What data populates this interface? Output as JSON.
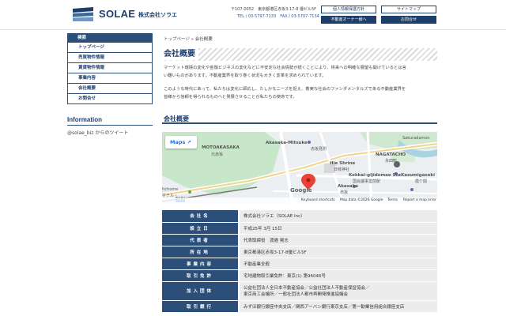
{
  "header": {
    "brand": "SOLAE",
    "brand_jp": "株式会社ソラエ",
    "address": "〒107-0052　東京都港区赤坂3-17-8 優ビル5F",
    "contact": "TEL / 03-5797-7133　FAX / 03-5797-7134",
    "buttons": {
      "privacy": "個人情報保護方針",
      "sitemap": "サイトマップ",
      "owner": "不動産オーナー様へ",
      "contact": "お問合せ"
    }
  },
  "sidebar": {
    "search": "検索",
    "items": [
      "トップページ",
      "売買物件情報",
      "賃貸物件情報",
      "事業内容",
      "会社概要",
      "お問合せ"
    ],
    "info_title": "Information",
    "tweet_text": "@solae_biz からのツイート"
  },
  "main": {
    "breadcrumb": "トップページ » 会社概要",
    "title": "会社概要",
    "para1_line1": "マーケット環境の変化や金融ビジネスの変化などに不安定な社会情勢が続くことにより、将来への明確な展望も開けているとは言",
    "para1_line2": "い難いものがあります。不動産業界を取り巻く状況も大きく変革を求められています。",
    "para2_line1": "このような時代にあって、私たちは変化に即応し、たしかなニーズを捉え、着実な社会のファンダメンタルズである不動産業界を",
    "para2_line2": "皆様から信頼を得られるものへと発展させることが私たちの使命です。",
    "section_title": "会社概要"
  },
  "map": {
    "maps_button": "Maps",
    "labels": {
      "motoakasaka": "MOTOAKASAKA",
      "motoakasaka_jp": "元赤坂",
      "akasaka_mitsuke": "Akasaka-Mitsuke",
      "akasaka_mitsuke_jp": "赤坂見附",
      "nagatacho": "NAGATACHO",
      "nagatacho_jp": "永田町",
      "sakuradamon": "Sakuradamon",
      "hie_shrine": "Hie Shrine",
      "hie_shrine_jp": "日枝神社",
      "kokkai": "Kokkai-gijidomae Sta.",
      "kokkai_jp": "国会議事堂前駅",
      "kasumigaseki": "Kasumigaseki",
      "kasumigaseki_jp": "霞ケ関",
      "akasaka": "Akasaka",
      "akasaka_jp": "赤坂",
      "hotel_left": "ltchome",
      "hotel_left2": "ホテル・",
      "route": "319"
    },
    "footer": {
      "google": "Google",
      "shortcuts": "Keyboard shortcuts",
      "mapdata": "Map data ©2026 Google",
      "terms": "Terms",
      "report": "Report a map error"
    }
  },
  "company_table": [
    {
      "key": "会社名",
      "value": "株式会社ソラエ（SOLAE Inc）"
    },
    {
      "key": "設立日",
      "value": "平成25年 3月 15日"
    },
    {
      "key": "代表者",
      "value": "代表取締役　渡邉 晃志"
    },
    {
      "key": "所在地",
      "value": "東京都港区赤坂3-17-8優ビル5F"
    },
    {
      "key": "事業内容",
      "value": "不動産業全般"
    },
    {
      "key": "取引免許",
      "value": "宅地建物取引業免許：東京(1) 第96046号"
    },
    {
      "key": "加入団体",
      "value": "公益社団法人全日本不動産協会／公益社団法人不動産保証協会／",
      "value2": "東京商工会議所／一般社団法人都市再開発推進協議会"
    },
    {
      "key": "取引銀行",
      "value": "みずほ銀行銀座中央支店／関西アーバン銀行東京支店／第一勧業信用組合銀座支店"
    }
  ],
  "colors": {
    "navy": "#1f3f6b",
    "nav_bg": "#2b4f78",
    "table_value_bg": "#ececec"
  }
}
